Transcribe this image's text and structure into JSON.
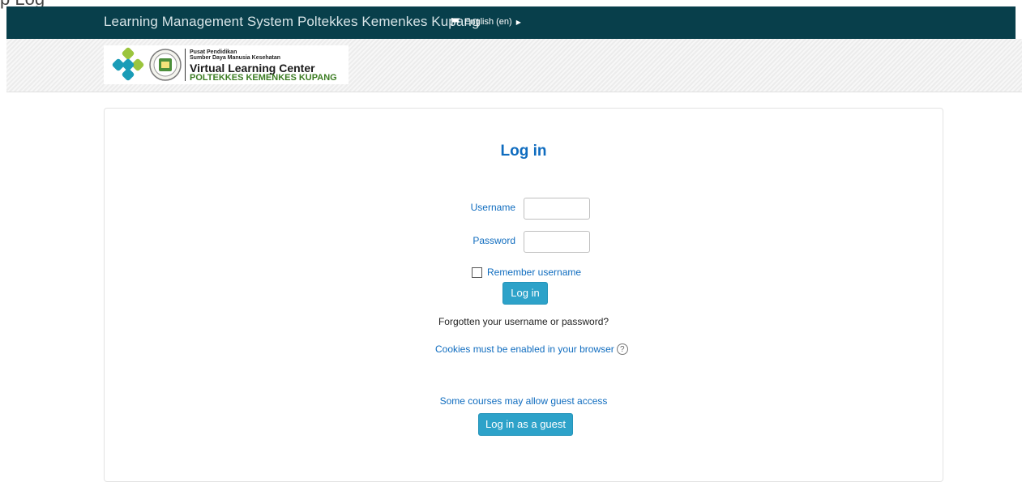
{
  "browser": {
    "partial_text": "p Log"
  },
  "navbar": {
    "site_name": "Learning Management System Poltekkes Kemenkes Kupang",
    "language": "English (en)"
  },
  "logo": {
    "line1": "Pusat Pendidikan",
    "line2": "Sumber Daya Manusia Kesehatan",
    "line3": "Virtual Learning Center",
    "line4": "POLTEKKES KEMENKES KUPANG"
  },
  "login": {
    "title": "Log in",
    "username_label": "Username",
    "username_value": "",
    "password_label": "Password",
    "password_value": "",
    "remember_label": "Remember username",
    "submit_label": "Log in",
    "forgot_link": "Forgotten your username or password?",
    "cookies_notice": "Cookies must be enabled in your browser",
    "guest_note": "Some courses may allow guest access",
    "guest_button": "Log in as a guest"
  },
  "icons": {
    "flag": "flag-icon",
    "caret": "caret-right-icon",
    "help": "question-circle-icon",
    "checkbox": "checkbox-unchecked"
  },
  "colors": {
    "navbar_bg": "#083f4b",
    "link": "#0f6cbf",
    "button": "#2da2c9"
  }
}
